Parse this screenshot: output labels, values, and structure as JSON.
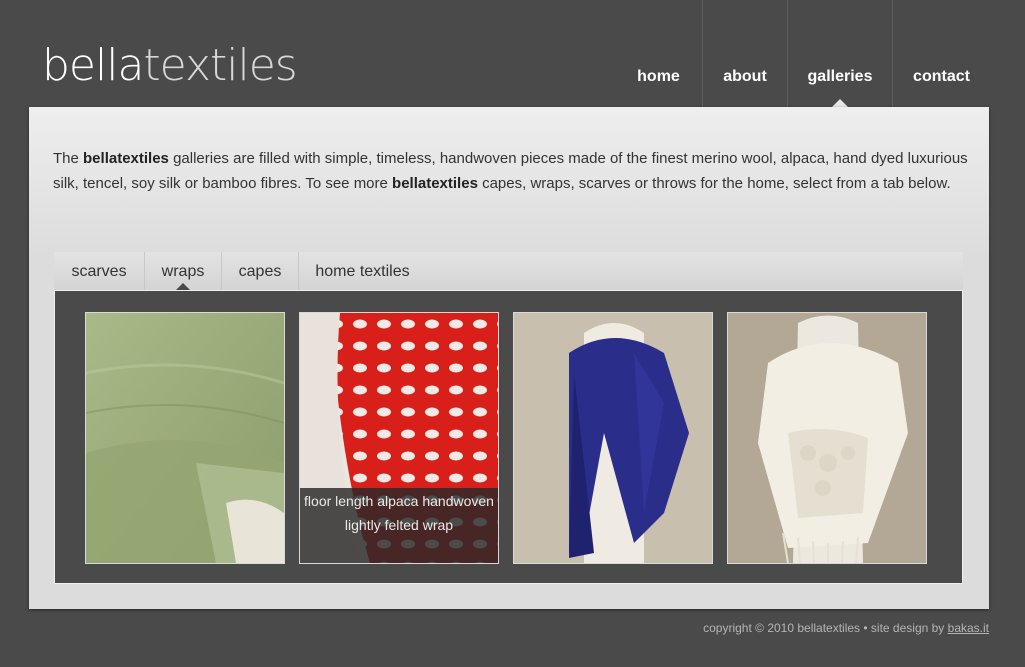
{
  "header": {
    "logo_part1": "bella",
    "logo_part2": "textiles",
    "nav": [
      {
        "label": "home"
      },
      {
        "label": "about"
      },
      {
        "label": "galleries"
      },
      {
        "label": "contact"
      }
    ],
    "active_nav": "galleries"
  },
  "intro": {
    "t1": "The ",
    "brand1": "bellatextiles",
    "t2": " galleries are filled with simple, timeless, handwoven pieces made of the finest merino wool, alpaca, hand dyed luxurious silk, tencel, soy silk or bamboo fibres. To see more ",
    "brand2": "bellatextiles",
    "t3": " capes, wraps, scarves or throws for the home, select from a tab below."
  },
  "tabs": [
    {
      "label": "scarves"
    },
    {
      "label": "wraps"
    },
    {
      "label": "capes"
    },
    {
      "label": "home textiles"
    }
  ],
  "active_tab": "wraps",
  "gallery": {
    "items": [
      {
        "image": "green-wrap-image",
        "color": "#9fb07f"
      },
      {
        "image": "red-wrap-image",
        "color": "#d81f1a",
        "caption": "floor length alpaca handwoven lightly felted wrap"
      },
      {
        "image": "blue-wrap-image",
        "color": "#2a2d8a"
      },
      {
        "image": "cream-wrap-image",
        "color": "#efeadc"
      }
    ]
  },
  "footer": {
    "copyright": "copyright © 2010 bellatextiles • site design by ",
    "designer": "bakas.it"
  },
  "colors": {
    "background": "#4a4a4a",
    "panel": "#dcdcdc",
    "text": "#333333"
  }
}
